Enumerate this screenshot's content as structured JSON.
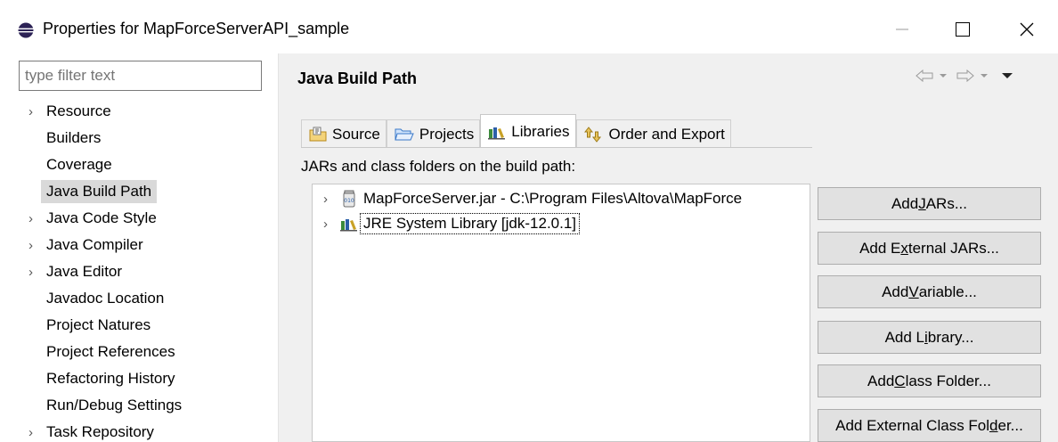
{
  "window": {
    "title": "Properties for MapForceServerAPI_sample",
    "minimize_icon": "minimize-icon",
    "maximize_icon": "maximize-icon",
    "close_icon": "close-icon"
  },
  "filter": {
    "placeholder": "type filter text"
  },
  "tree": [
    {
      "label": "Resource",
      "expandable": true
    },
    {
      "label": "Builders",
      "expandable": false
    },
    {
      "label": "Coverage",
      "expandable": false
    },
    {
      "label": "Java Build Path",
      "expandable": false,
      "selected": true
    },
    {
      "label": "Java Code Style",
      "expandable": true
    },
    {
      "label": "Java Compiler",
      "expandable": true
    },
    {
      "label": "Java Editor",
      "expandable": true
    },
    {
      "label": "Javadoc Location",
      "expandable": false
    },
    {
      "label": "Project Natures",
      "expandable": false
    },
    {
      "label": "Project References",
      "expandable": false
    },
    {
      "label": "Refactoring History",
      "expandable": false
    },
    {
      "label": "Run/Debug Settings",
      "expandable": false
    },
    {
      "label": "Task Repository",
      "expandable": true
    }
  ],
  "page": {
    "title": "Java Build Path",
    "tabs": [
      {
        "label": "Source",
        "icon": "source-folder-icon"
      },
      {
        "label": "Projects",
        "icon": "projects-folder-icon"
      },
      {
        "label": "Libraries",
        "icon": "libraries-icon",
        "active": true
      },
      {
        "label": "Order and Export",
        "icon": "order-export-icon"
      }
    ],
    "section_label": "JARs and class folders on the build path:",
    "entries": [
      {
        "label": "MapForceServer.jar - C:\\Program Files\\Altova\\MapForce",
        "icon": "jar-icon"
      },
      {
        "label": "JRE System Library [jdk-12.0.1]",
        "icon": "library-icon",
        "focused": true
      }
    ],
    "buttons": [
      {
        "pre": "Add ",
        "mn": "J",
        "post": "ARs..."
      },
      {
        "pre": "Add E",
        "mn": "x",
        "post": "ternal JARs..."
      },
      {
        "pre": "Add ",
        "mn": "V",
        "post": "ariable..."
      },
      {
        "pre": "Add L",
        "mn": "i",
        "post": "brary..."
      },
      {
        "pre": "Add ",
        "mn": "C",
        "post": "lass Folder..."
      },
      {
        "pre": "Add External Class Fol",
        "mn": "d",
        "post": "er..."
      }
    ]
  }
}
